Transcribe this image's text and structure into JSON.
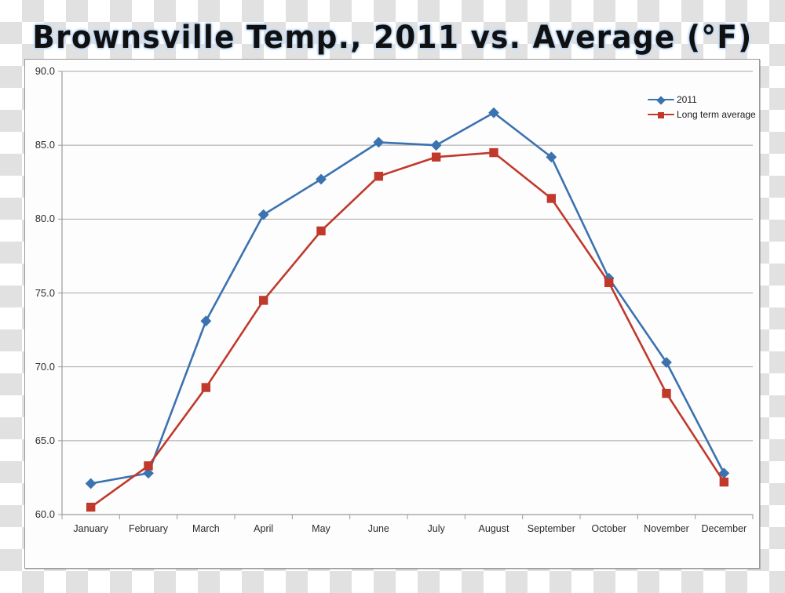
{
  "title": "Brownsville Temp., 2011 vs. Average (°F)",
  "legend": {
    "position": "top-right",
    "entries": [
      {
        "label": "2011",
        "color": "#3b72b0",
        "marker": "diamond"
      },
      {
        "label": "Long term average",
        "color": "#c0392b",
        "marker": "square"
      }
    ]
  },
  "axis": {
    "y_ticks": [
      "90.0",
      "85.0",
      "80.0",
      "75.0",
      "70.0",
      "65.0",
      "60.0"
    ],
    "x_ticks": [
      "January",
      "February",
      "March",
      "April",
      "May",
      "June",
      "July",
      "August",
      "September",
      "October",
      "November",
      "December"
    ]
  },
  "colors": {
    "series_2011": "#3b72b0",
    "series_average": "#c0392b",
    "gridline": "#a6a6a6",
    "axis": "#9a9a9a",
    "panel_background": "#fdfdfd",
    "title_glow": "#b9d2ef"
  },
  "chart_data": {
    "type": "line",
    "title": "Brownsville Temp., 2011 vs. Average (°F)",
    "xlabel": "",
    "ylabel": "",
    "ylim": [
      60.0,
      90.0
    ],
    "ytick_step": 5.0,
    "grid": true,
    "legend_position": "top-right",
    "categories": [
      "January",
      "February",
      "March",
      "April",
      "May",
      "June",
      "July",
      "August",
      "September",
      "October",
      "November",
      "December"
    ],
    "series": [
      {
        "name": "2011",
        "color": "#3b72b0",
        "marker": "diamond",
        "values": [
          62.1,
          62.8,
          73.1,
          80.3,
          82.7,
          85.2,
          85.0,
          87.2,
          84.2,
          76.0,
          70.3,
          62.8
        ]
      },
      {
        "name": "Long term average",
        "color": "#c0392b",
        "marker": "square",
        "values": [
          60.5,
          63.3,
          68.6,
          74.5,
          79.2,
          82.9,
          84.2,
          84.5,
          81.4,
          75.7,
          68.2,
          62.2
        ]
      }
    ]
  }
}
